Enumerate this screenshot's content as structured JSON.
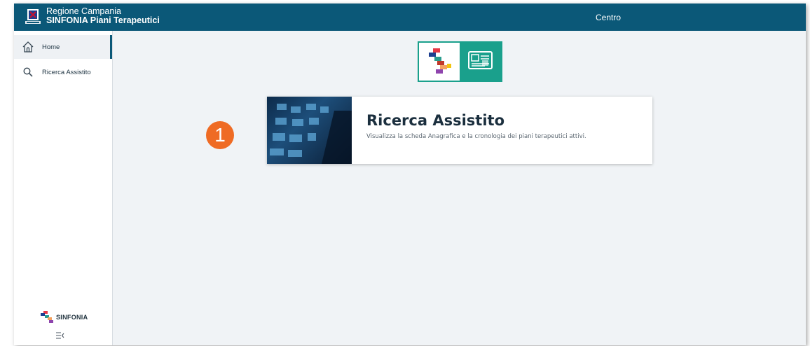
{
  "header": {
    "brand_line1": "Regione Campania",
    "brand_line2": "SINFONIA Piani Terapeutici",
    "center_label": "Centro"
  },
  "sidebar": {
    "items": [
      {
        "label": "Home",
        "icon": "home-icon",
        "active": true
      },
      {
        "label": "Ricerca Assistito",
        "icon": "search-icon",
        "active": false
      }
    ],
    "footer_logo": "SINFONIA",
    "collapse_icon": "collapse-menu-icon"
  },
  "main": {
    "card": {
      "title": "Ricerca Assistito",
      "description": "Visualizza la scheda Anagrafica e la cronologia dei piani terapeutici attivi."
    },
    "annotation_badge": "1"
  },
  "colors": {
    "topbar": "#0b5878",
    "accent_teal": "#1aa08c",
    "badge": "#ef6b24"
  }
}
